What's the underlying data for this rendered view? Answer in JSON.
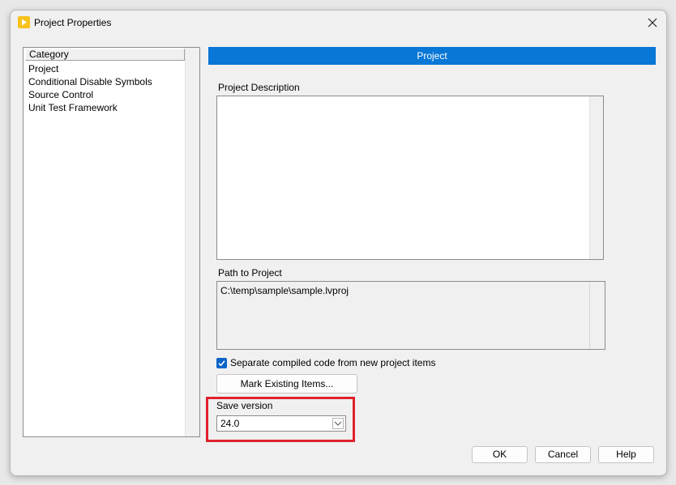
{
  "window": {
    "title": "Project Properties"
  },
  "category": {
    "header": "Category",
    "items": [
      "Project",
      "Conditional Disable Symbols",
      "Source Control",
      "Unit Test Framework"
    ],
    "selected_index": 0
  },
  "project": {
    "section_title": "Project",
    "description_label": "Project Description",
    "description_value": "",
    "path_label": "Path to Project",
    "path_value": "C:\\temp\\sample\\sample.lvproj",
    "separate_compiled_label": "Separate compiled code from new project items",
    "separate_compiled_checked": true,
    "mark_existing_label": "Mark Existing Items...",
    "save_version_label": "Save version",
    "save_version_value": "24.0"
  },
  "buttons": {
    "ok": "OK",
    "cancel": "Cancel",
    "help": "Help"
  },
  "colors": {
    "accent": "#0877d6",
    "selection": "#0a64c8",
    "highlight_box": "#e0212c"
  }
}
